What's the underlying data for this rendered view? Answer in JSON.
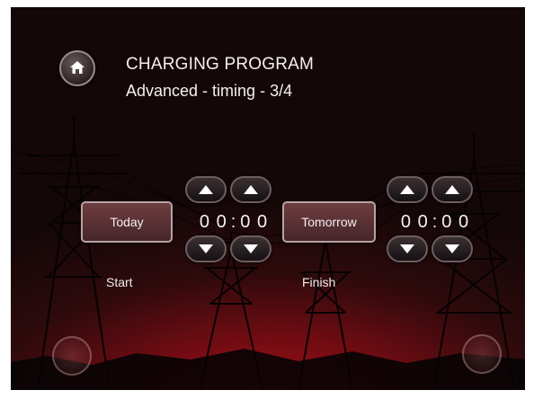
{
  "header": {
    "title": "CHARGING PROGRAM",
    "subtitle": "Advanced - timing - 3/4"
  },
  "start": {
    "day_label": "Today",
    "hours": "0 0",
    "separator": ":",
    "minutes": "0 0",
    "caption": "Start"
  },
  "finish": {
    "day_label": "Tomorrow",
    "hours": "0 0",
    "separator": ":",
    "minutes": "0 0",
    "caption": "Finish"
  },
  "icons": {
    "home": "home-icon",
    "up": "chevron-up-icon",
    "down": "chevron-down-icon"
  },
  "colors": {
    "background_glow": "#b3101a",
    "background_dark": "#140708",
    "button_fill": "#6e3d40",
    "button_border": "#b8a3a3",
    "text": "#f4f0f0"
  }
}
